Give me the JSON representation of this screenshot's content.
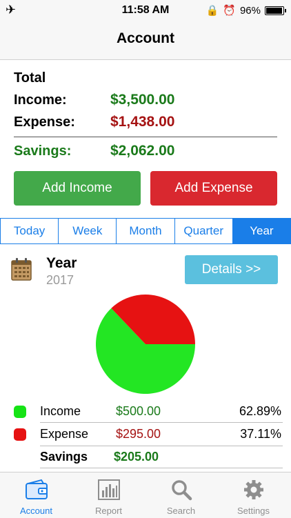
{
  "status": {
    "time": "11:58 AM",
    "battery": "96%"
  },
  "nav": {
    "title": "Account"
  },
  "summary": {
    "heading": "Total",
    "income_label": "Income:",
    "income_value": "$3,500.00",
    "expense_label": "Expense:",
    "expense_value": "$1,438.00",
    "savings_label": "Savings:",
    "savings_value": "$2,062.00"
  },
  "buttons": {
    "add_income": "Add Income",
    "add_expense": "Add Expense"
  },
  "tabs": [
    {
      "label": "Today"
    },
    {
      "label": "Week"
    },
    {
      "label": "Month"
    },
    {
      "label": "Quarter"
    },
    {
      "label": "Year"
    }
  ],
  "active_tab": "Year",
  "period": {
    "title": "Year",
    "year": "2017",
    "details": "Details >>"
  },
  "chart_data": {
    "type": "pie",
    "slices": [
      {
        "label": "Income",
        "value": 62.89,
        "color": "#23e623"
      },
      {
        "label": "Expense",
        "value": 37.11,
        "color": "#e61212"
      }
    ]
  },
  "legend": {
    "income": {
      "label": "Income",
      "amount": "$500.00",
      "pct": "62.89%",
      "color": "#16e316"
    },
    "expense": {
      "label": "Expense",
      "amount": "$295.00",
      "pct": "37.11%",
      "color": "#e61212"
    },
    "savings": {
      "label": "Savings",
      "amount": "$205.00"
    }
  },
  "tabbar": [
    {
      "label": "Account",
      "icon": "wallet-icon"
    },
    {
      "label": "Report",
      "icon": "bar-chart-icon"
    },
    {
      "label": "Search",
      "icon": "search-icon"
    },
    {
      "label": "Settings",
      "icon": "gear-icon"
    }
  ],
  "colors": {
    "accent": "#1a7ee8",
    "income_green": "#1a7a1a",
    "expense_red": "#a51212",
    "details_blue": "#5bc0de"
  }
}
